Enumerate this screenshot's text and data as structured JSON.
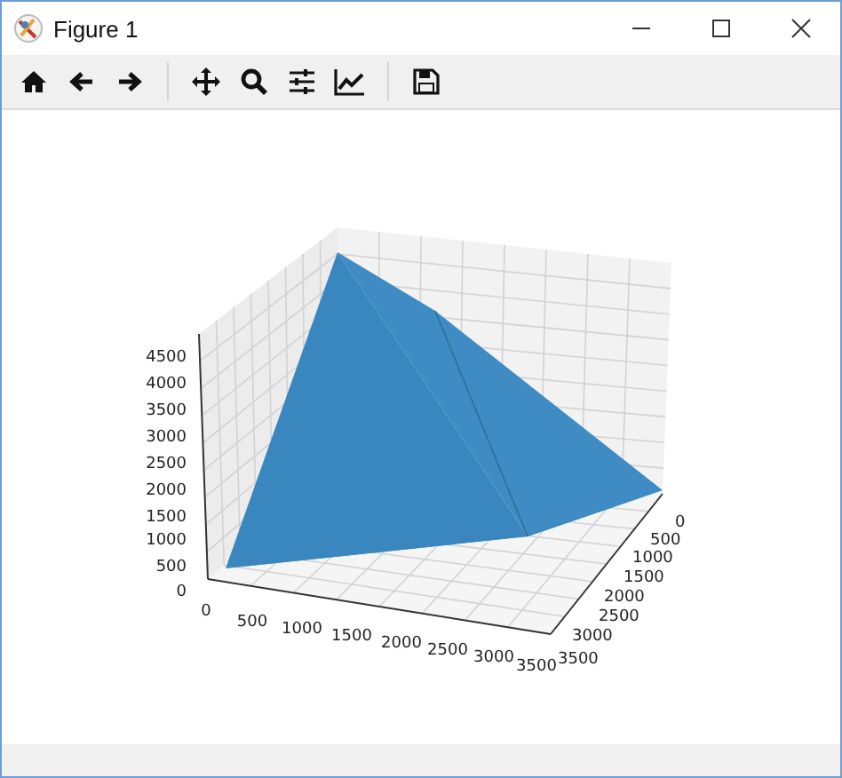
{
  "window": {
    "title": "Figure 1"
  },
  "plot": {
    "z_ticks": [
      "4500",
      "4000",
      "3500",
      "3000",
      "2500",
      "2000",
      "1500",
      "1000",
      "500",
      "0"
    ],
    "x_ticks": [
      "0",
      "500",
      "1000",
      "1500",
      "2000",
      "2500",
      "3000",
      "3500"
    ],
    "y_ticks": [
      "0",
      "500",
      "1000",
      "1500",
      "2000",
      "2500",
      "3000",
      "3500"
    ]
  }
}
